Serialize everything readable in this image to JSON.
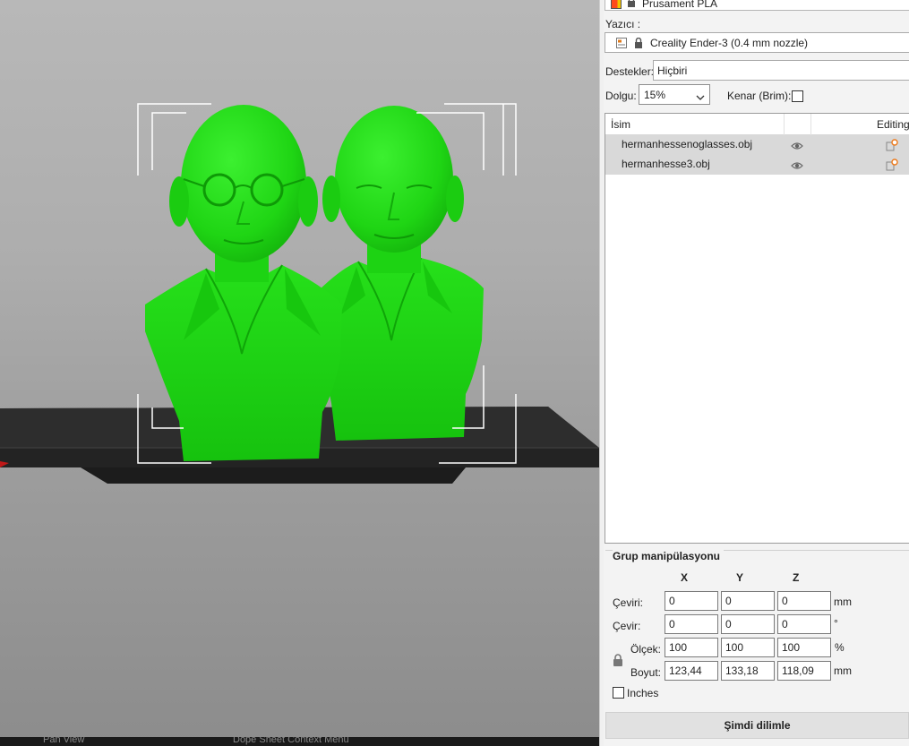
{
  "viewport": {
    "objects": [
      "hermanhessenoglasses.obj",
      "hermanhesse3.obj"
    ],
    "colors": {
      "model": "#1fdc14",
      "bed": "#2e2e2e",
      "selection": "#ffffff"
    }
  },
  "bottom_bar": {
    "items": [
      "Pan View",
      "Dope Sheet Context Menu"
    ]
  },
  "panel": {
    "filament": {
      "name": "Prusament PLA"
    },
    "printer": {
      "label": "Yazıcı :",
      "name": "Creality Ender-3 (0.4 mm nozzle)"
    },
    "supports": {
      "label": "Destekler:",
      "value": "Hiçbiri"
    },
    "infill": {
      "label": "Dolgu:",
      "value": "15%"
    },
    "brim": {
      "label": "Kenar (Brim):"
    },
    "list": {
      "col_name": "İsim",
      "col_editing": "Editing",
      "rows": [
        {
          "name": "hermanhessenoglasses.obj"
        },
        {
          "name": "hermanhesse3.obj"
        }
      ]
    },
    "group": {
      "title": "Grup manipülasyonu",
      "axes": [
        "X",
        "Y",
        "Z"
      ],
      "translate": {
        "label": "Çeviri:",
        "x": "0",
        "y": "0",
        "z": "0",
        "unit": "mm"
      },
      "rotate": {
        "label": "Çevir:",
        "x": "0",
        "y": "0",
        "z": "0",
        "unit": "°"
      },
      "scale": {
        "label": "Ölçek:",
        "x": "100",
        "y": "100",
        "z": "100",
        "unit": "%"
      },
      "size": {
        "label": "Boyut:",
        "x": "123,44",
        "y": "133,18",
        "z": "118,09",
        "unit": "mm"
      },
      "inches_label": "Inches"
    },
    "slice_button": "Şimdi dilimle"
  }
}
